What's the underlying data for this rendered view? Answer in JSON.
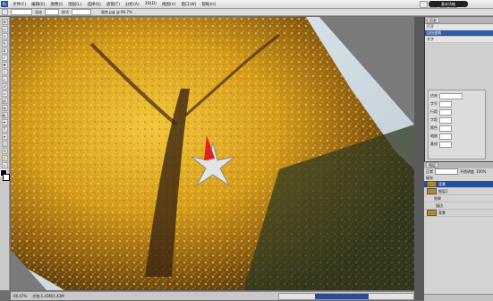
{
  "menubar": {
    "logo": "Ps",
    "items": [
      "文件(F)",
      "编辑(E)",
      "图像(I)",
      "图层(L)",
      "选择(S)",
      "滤镜(T)",
      "分析(A)",
      "3D(D)",
      "视图(V)",
      "窗口(W)",
      "帮助(H)"
    ],
    "workspace": "基本功能"
  },
  "optionsbar": {
    "label_1": "羽化",
    "label_2": "样式",
    "doc_title": "银杏.jpg @ 66.7%"
  },
  "statusbar": {
    "zoom": "66.67%",
    "info": "文档:1.43M/1.43M"
  },
  "history": {
    "rows": [
      "打开",
      "自由变换",
      "文字"
    ]
  },
  "character": {
    "font_label": "仿宋",
    "size_label": "字号",
    "leading_label": "行距",
    "tracking_label": "字距",
    "row_labels": [
      "颜色",
      "缩放",
      "基线"
    ]
  },
  "layers": {
    "tab": "图层",
    "blend_label": "正常",
    "opacity_label": "不透明度",
    "opacity_value": "100%",
    "fill_label": "填充",
    "rows": [
      "背景",
      "图层1",
      "效果",
      "描边",
      "背景"
    ]
  },
  "colors": {
    "accent": "#2d5fa8",
    "foliage": "#d9a21b"
  }
}
